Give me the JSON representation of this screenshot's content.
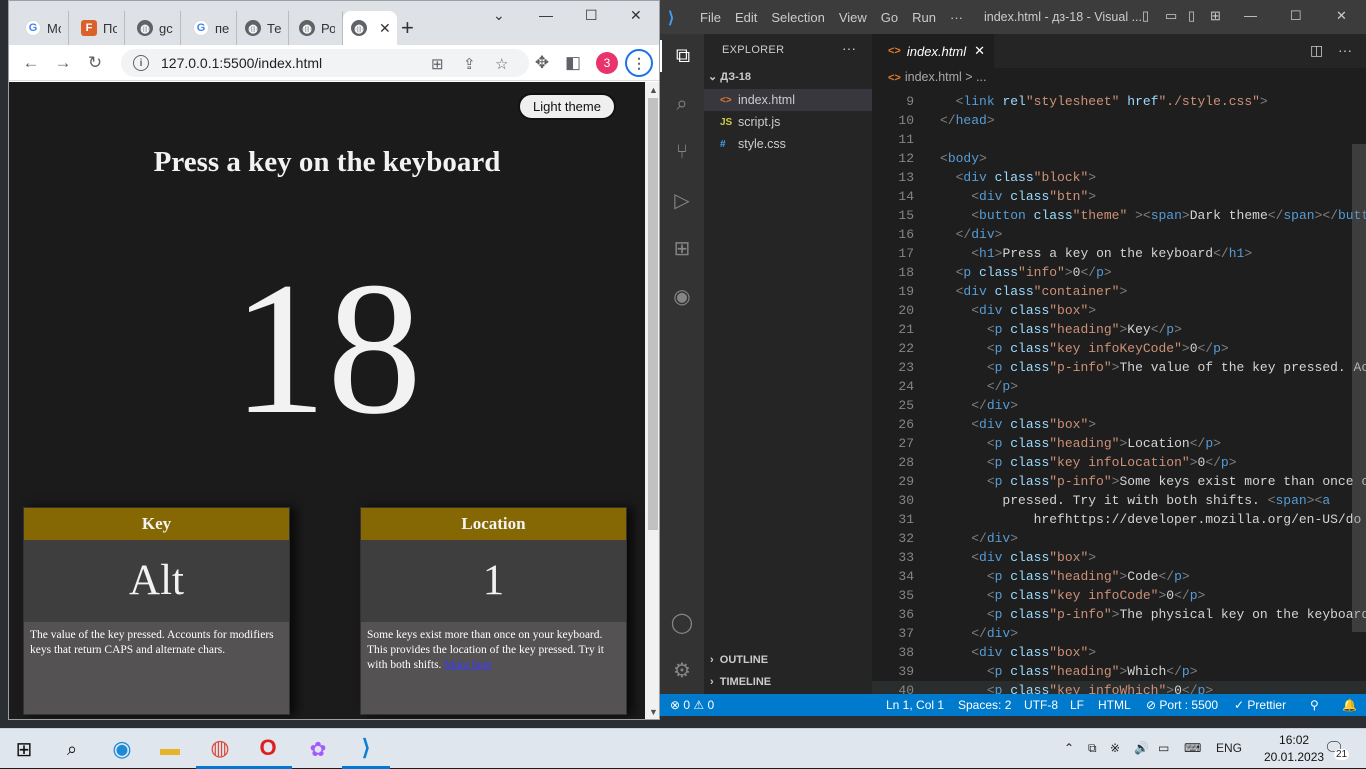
{
  "browser": {
    "tabs": [
      {
        "icon": "google-icon",
        "title": "Мо"
      },
      {
        "icon": "figma-icon",
        "title": "По"
      },
      {
        "icon": "globe-icon",
        "title": "gc"
      },
      {
        "icon": "google-icon",
        "title": "пе"
      },
      {
        "icon": "globe-icon",
        "title": "Те"
      },
      {
        "icon": "globe-icon",
        "title": "Ро"
      },
      {
        "icon": "globe-icon",
        "title": ""
      }
    ],
    "url": "127.0.0.1:5500/index.html",
    "profile_badge": "3"
  },
  "page": {
    "theme_button": "Light theme",
    "title": "Press a key on the keyboard",
    "info": "18",
    "boxes": [
      {
        "heading": "Key",
        "value": "Alt",
        "description": "The value of the key pressed. Accounts for modifiers keys that return CAPS and alternate chars.",
        "link": ""
      },
      {
        "heading": "Location",
        "value": "1",
        "description": "Some keys exist more than once on your keyboard. This provides the location of the key pressed. Try it with both shifts.",
        "link": "More here"
      }
    ]
  },
  "vscode": {
    "menu": [
      "File",
      "Edit",
      "Selection",
      "View",
      "Go",
      "Run",
      "···"
    ],
    "window_title": "index.html - дз-18 - Visual ...",
    "explorer_label": "EXPLORER",
    "folder": "ДЗ-18",
    "files": [
      {
        "name": "index.html",
        "icon": "<>"
      },
      {
        "name": "script.js",
        "icon": "JS"
      },
      {
        "name": "style.css",
        "icon": "#"
      }
    ],
    "outline": "OUTLINE",
    "timeline": "TIMELINE",
    "tab": "index.html",
    "breadcrumb": "index.html > ...",
    "code_lines": [
      {
        "n": "9",
        "html": "  <link rel=\"stylesheet\" href=\"./style.css\">"
      },
      {
        "n": "10",
        "html": "</head>"
      },
      {
        "n": "11",
        "html": ""
      },
      {
        "n": "12",
        "html": "<body>"
      },
      {
        "n": "13",
        "html": "  <div class=\"block\">"
      },
      {
        "n": "14",
        "html": "    <div class=\"btn\">"
      },
      {
        "n": "15",
        "html": "    <button class=\"theme\" ><span>Dark theme</span></butt"
      },
      {
        "n": "16",
        "html": "  </div>"
      },
      {
        "n": "17",
        "html": "    <h1>Press a key on the keyboard</h1>"
      },
      {
        "n": "18",
        "html": "  <p class=\"info\">0</p>"
      },
      {
        "n": "19",
        "html": "  <div class=\"container\">"
      },
      {
        "n": "20",
        "html": "    <div class=\"box\">"
      },
      {
        "n": "21",
        "html": "      <p class=\"heading\">Key</p>"
      },
      {
        "n": "22",
        "html": "      <p class=\"key infoKeyCode\">0</p>"
      },
      {
        "n": "23",
        "html": "      <p class=\"p-info\">The value of the key pressed. Ac"
      },
      {
        "n": "24",
        "html": "      </p>"
      },
      {
        "n": "25",
        "html": "    </div>"
      },
      {
        "n": "26",
        "html": "    <div class=\"box\">"
      },
      {
        "n": "27",
        "html": "      <p class=\"heading\">Location</p>"
      },
      {
        "n": "28",
        "html": "      <p class=\"key infoLocation\">0</p>"
      },
      {
        "n": "29",
        "html": "      <p class=\"p-info\">Some keys exist more than once o"
      },
      {
        "n": "30",
        "html": "        pressed. Try it with both shifts. <span><a"
      },
      {
        "n": "31",
        "html": "            href=\"https://developer.mozilla.org/en-US/do"
      },
      {
        "n": "32",
        "html": "    </div>"
      },
      {
        "n": "33",
        "html": "    <div class=\"box\">"
      },
      {
        "n": "34",
        "html": "      <p class=\"heading\">Code</p>"
      },
      {
        "n": "35",
        "html": "      <p class=\"key infoCode\">0</p>"
      },
      {
        "n": "36",
        "html": "      <p class=\"p-info\">The physical key on the keyboard"
      },
      {
        "n": "37",
        "html": "    </div>"
      },
      {
        "n": "38",
        "html": "    <div class=\"box\">"
      },
      {
        "n": "39",
        "html": "      <p class=\"heading\">Which</p>"
      },
      {
        "n": "40",
        "html": "      <p class=\"key infoWhich\">0</p>"
      }
    ],
    "status": {
      "problems": "⊗ 0 ⚠ 0",
      "position": "Ln 1, Col 1",
      "spaces": "Spaces: 2",
      "encoding": "UTF-8",
      "eol": "LF",
      "language": "HTML",
      "port": "⊘ Port : 5500",
      "prettier": "✓ Prettier"
    }
  },
  "taskbar": {
    "language": "ENG",
    "time": "16:02",
    "date": "20.01.2023",
    "notifications": "21"
  }
}
